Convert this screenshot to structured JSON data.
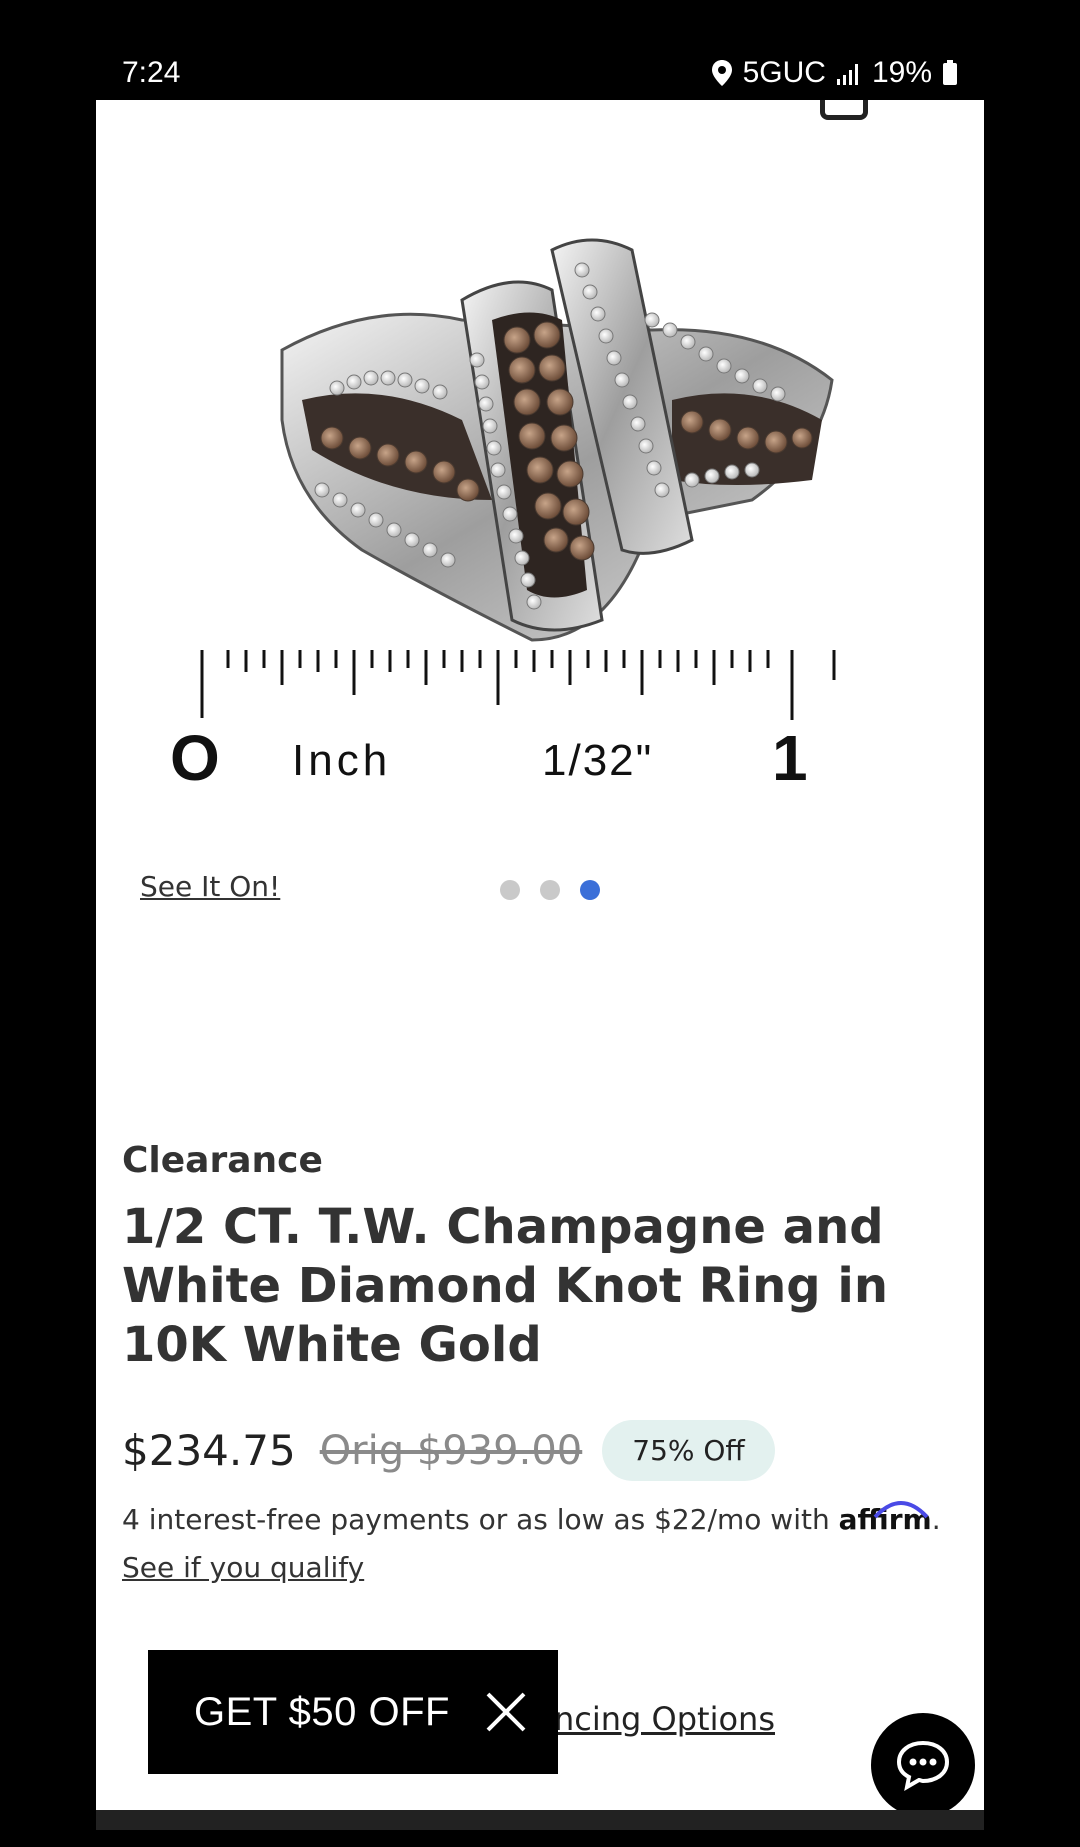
{
  "status_bar": {
    "time": "7:24",
    "network": "5GUC",
    "battery": "19%",
    "icons": [
      "location-icon",
      "signal-icon",
      "battery-icon"
    ]
  },
  "gallery": {
    "see_it_on": "See It On!",
    "dots": 3,
    "active_dot": 3,
    "ruler_labels": {
      "zero": "O",
      "unit": "Inch",
      "fraction": "1/32\"",
      "one": "1"
    }
  },
  "product": {
    "tag": "Clearance",
    "title": "1/2 CT. T.W. Champagne and White Diamond Knot Ring in 10K White Gold",
    "price": "$234.75",
    "original_price": "Orig $939.00",
    "discount": "75% Off",
    "payments_text": "4 interest-free payments or as low as $22/mo with ",
    "affirm": "affirm",
    "payments_suffix": ".",
    "qualify_link": "See if you qualify",
    "financing_link": "ncing Options"
  },
  "promo": {
    "label": "GET $50 OFF"
  },
  "colors": {
    "accent_dot": "#3b6fd8",
    "badge_bg": "#e3f1ef"
  }
}
